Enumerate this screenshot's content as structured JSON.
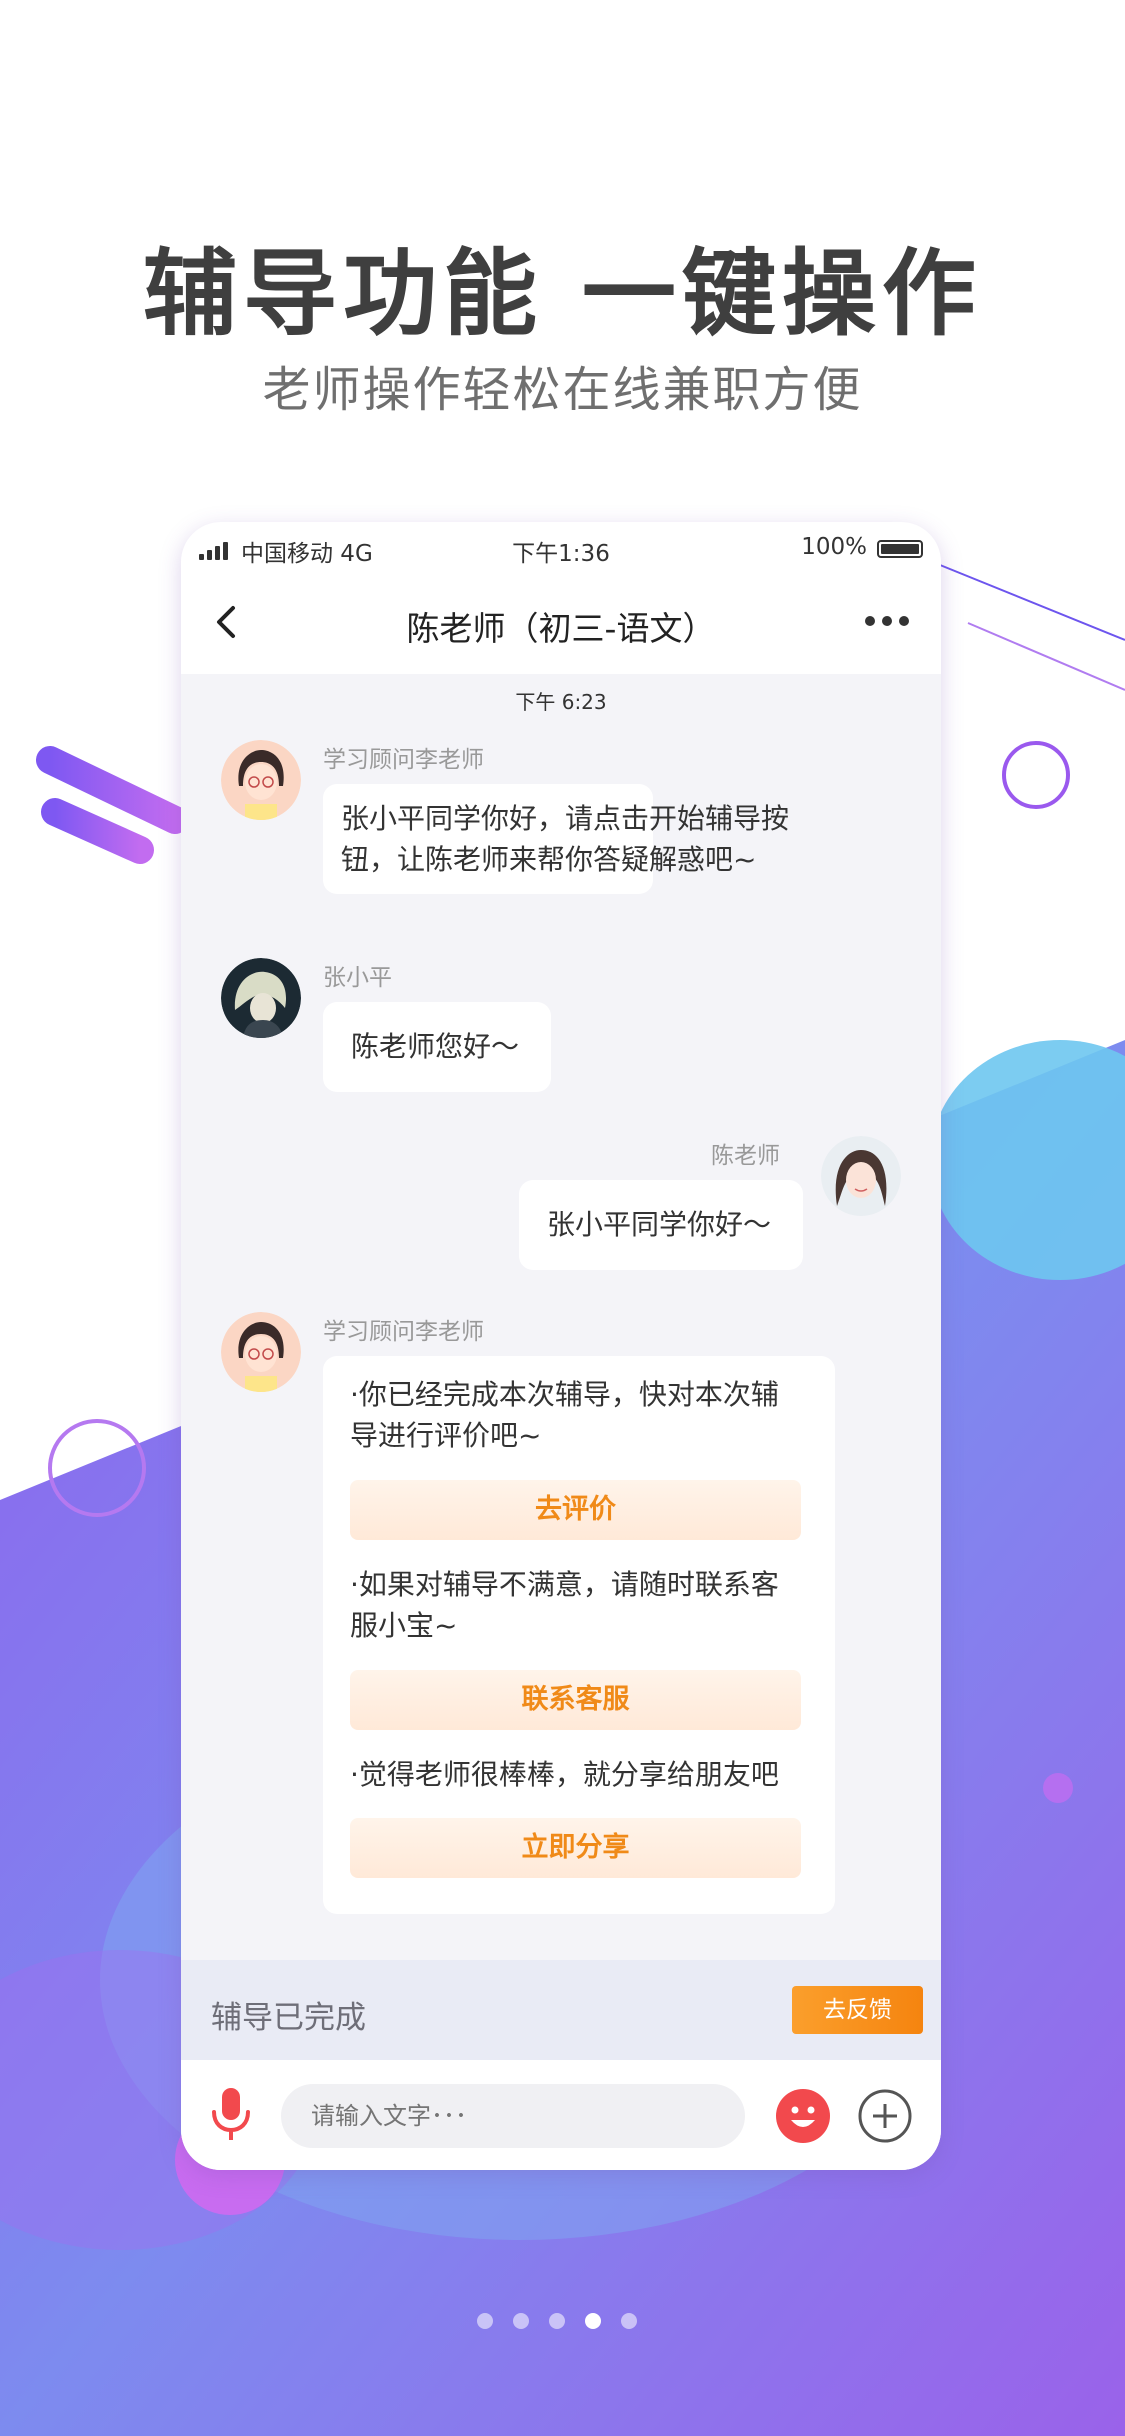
{
  "headline": "辅导功能 一键操作",
  "subheadline": "老师操作轻松在线兼职方便",
  "status_bar": {
    "carrier": "中国移动 4G",
    "time": "下午1:36",
    "battery": "100%"
  },
  "nav": {
    "title": "陈老师（初三-语文）"
  },
  "chat": {
    "timestamp": "下午 6:23",
    "messages": [
      {
        "sender": "学习顾问李老师",
        "lines": [
          "张小平同学你好，请点击开始辅导按",
          "钮，让陈老师来帮你答疑解惑吧~"
        ]
      },
      {
        "sender": "张小平",
        "lines": [
          "陈老师您好～"
        ]
      },
      {
        "sender": "陈老师",
        "lines": [
          "张小平同学你好～"
        ]
      },
      {
        "sender": "学习顾问李老师",
        "items": [
          {
            "lines": [
              "·你已经完成本次辅导，快对本次辅",
              "导进行评价吧~"
            ],
            "button": "去评价"
          },
          {
            "lines": [
              "·如果对辅导不满意，请随时联系客",
              "服小宝~"
            ],
            "button": "联系客服"
          },
          {
            "lines": [
              "·觉得老师很棒棒，就分享给朋友吧"
            ],
            "button": "立即分享"
          }
        ]
      }
    ]
  },
  "footer": {
    "status": "辅导已完成",
    "feedback_button": "去反馈"
  },
  "input": {
    "placeholder": "请输入文字･･･"
  },
  "pagination": {
    "count": 5,
    "active_index": 3
  },
  "colors": {
    "accent_orange": "#f5840f",
    "background_purple": "#8d6bf0",
    "mic_red": "#f2494d"
  }
}
